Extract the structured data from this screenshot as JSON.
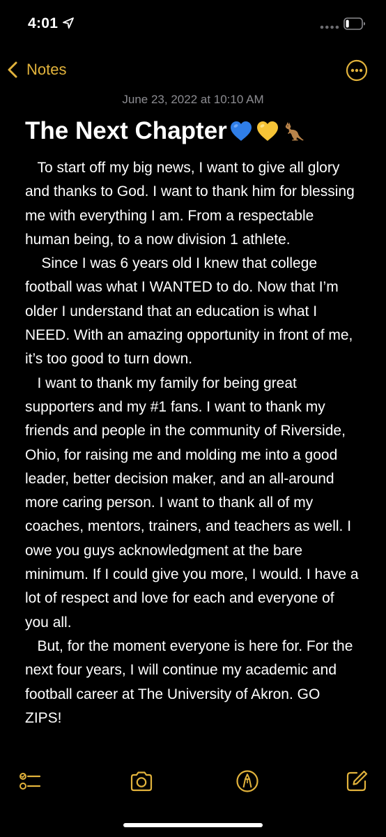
{
  "status_bar": {
    "time": "4:01",
    "location_icon": "location-arrow-icon",
    "signal_icon": "signal-dots-icon",
    "battery_icon": "battery-icon",
    "battery_level": 0.2
  },
  "nav": {
    "back_label": "Notes",
    "back_icon": "chevron-left-icon",
    "more_icon": "ellipsis-circle-icon"
  },
  "note": {
    "date": "June 23, 2022 at 10:10 AM",
    "title": "The Next Chapter",
    "title_emojis": [
      "blue-heart-icon",
      "yellow-heart-icon",
      "kangaroo-icon"
    ],
    "paragraphs": [
      "   To start off my big news, I want to give all glory and thanks to God. I want to thank him for blessing me with everything I am. From a respectable human being, to a now division 1 athlete.",
      "    Since I was 6 years old I knew that college football was what I WANTED to do. Now that I’m older I understand that an education is what I NEED. With an amazing opportunity in front of me, it’s too good to turn down.",
      "   I want to thank my family for being great supporters and my #1 fans. I want to thank my friends and people in the community of Riverside, Ohio, for raising me and molding me into a good leader, better decision maker, and an all-around more caring person. I want to thank all of my coaches, mentors, trainers, and teachers as well. I owe you guys acknowledgment at the bare minimum. If I could give you more, I would. I have a lot of respect and love for each and everyone of you all.",
      "   But, for the moment everyone is here for. For the next four years, I will continue my academic and football career at The University of Akron. GO ZIPS!"
    ]
  },
  "toolbar": {
    "items": [
      "checklist-icon",
      "camera-icon",
      "markup-pen-icon",
      "compose-icon"
    ]
  },
  "colors": {
    "accent": "#e2b33c",
    "background": "#000000",
    "text": "#ffffff",
    "secondary_text": "#8d8d92"
  }
}
